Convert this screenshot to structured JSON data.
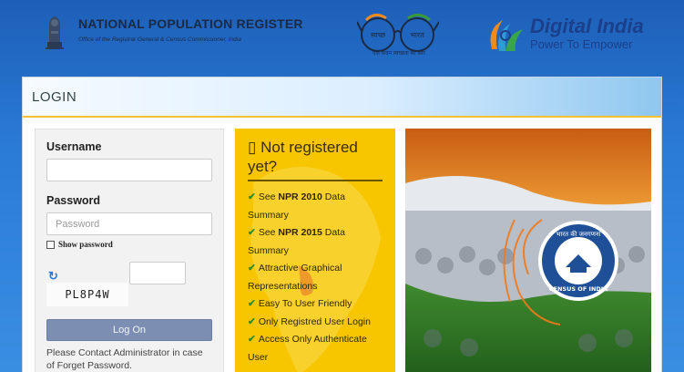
{
  "header": {
    "title": "NATIONAL POPULATION REGISTER",
    "subtitle": "Office of the Registrar General & Census Commissioner, India",
    "swachh_left": "स्वच्छ",
    "swachh_right": "भारत",
    "swachh_tagline": "एक कदम स्वच्छता की ओर",
    "digital_india_title": "Digital India",
    "digital_india_sub": "Power To Empower"
  },
  "login": {
    "heading": "LOGIN",
    "username_label": "Username",
    "username_value": "",
    "password_label": "Password",
    "password_placeholder": "Password",
    "show_password_label": "Show password",
    "captcha_text": "PL8P4W",
    "captcha_value": "",
    "login_button": "Log On",
    "contact_text": "Please Contact Administrator in case of Forget Password."
  },
  "not_registered": {
    "title": "Not registered yet?",
    "items": [
      {
        "bold_prefix": "See ",
        "bold": "NPR 2010",
        "rest": " Data Summary"
      },
      {
        "bold_prefix": "See ",
        "bold": "NPR 2015",
        "rest": " Data Summary"
      },
      {
        "bold_prefix": "",
        "bold": "",
        "rest": "Attractive Graphical Representations"
      },
      {
        "bold_prefix": "",
        "bold": "",
        "rest": "Easy To User Friendly"
      },
      {
        "bold_prefix": "",
        "bold": "",
        "rest": "Only Registred User Login"
      },
      {
        "bold_prefix": "",
        "bold": "",
        "rest": "Access Only Authenticate User"
      }
    ]
  },
  "banner": {
    "seal_top": "भारत की जनगणना",
    "seal_bottom": "CENSUS OF INDIA"
  },
  "colors": {
    "accent_yellow": "#f7c600",
    "button": "#7c8fb2",
    "header_blue": "#2a7bd6",
    "tick_green": "#2f8a2a"
  }
}
